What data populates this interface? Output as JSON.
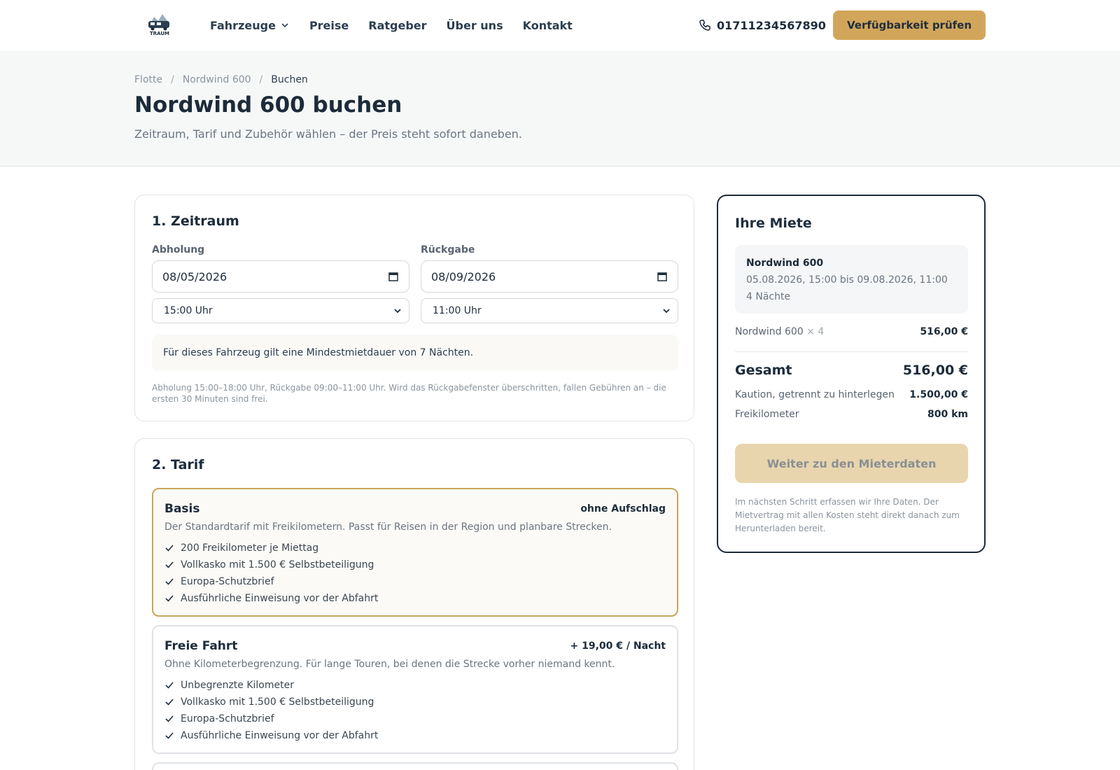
{
  "header": {
    "logo_text": "TRAUM",
    "nav": [
      {
        "label": "Fahrzeuge",
        "has_dropdown": true
      },
      {
        "label": "Preise"
      },
      {
        "label": "Ratgeber"
      },
      {
        "label": "Über uns"
      },
      {
        "label": "Kontakt"
      }
    ],
    "phone": "01711234567890",
    "cta_label": "Verfügbarkeit prüfen"
  },
  "hero": {
    "breadcrumb": [
      "Flotte",
      "Nordwind 600",
      "Buchen"
    ],
    "breadcrumb_sep": "/",
    "title": "Nordwind 600 buchen",
    "subtitle": "Zeitraum, Tarif und Zubehör wählen – der Preis steht sofort daneben."
  },
  "period": {
    "heading": "1. Zeitraum",
    "pickup_label": "Abholung",
    "pickup_date": "08/05/2026",
    "pickup_time": "15:00 Uhr",
    "return_label": "Rückgabe",
    "return_date": "08/09/2026",
    "return_time": "11:00 Uhr",
    "notice": "Für dieses Fahrzeug gilt eine Mindestmietdauer von 7 Nächten.",
    "fine_print": "Abholung 15:00–18:00 Uhr, Rückgabe 09:00–11:00 Uhr. Wird das Rückgabefenster überschritten, fallen Gebühren an – die ersten 30 Minuten sind frei."
  },
  "tariff": {
    "heading": "2. Tarif",
    "options": [
      {
        "name": "Basis",
        "price": "ohne Aufschlag",
        "description": "Der Standardtarif mit Freikilometern. Passt für Reisen in der Region und planbare Strecken.",
        "features": [
          "200 Freikilometer je Miettag",
          "Vollkasko mit 1.500 € Selbstbeteiligung",
          "Europa-Schutzbrief",
          "Ausführliche Einweisung vor der Abfahrt"
        ],
        "selected": true
      },
      {
        "name": "Freie Fahrt",
        "price": "+ 19,00 € / Nacht",
        "description": "Ohne Kilometerbegrenzung. Für lange Touren, bei denen die Strecke vorher niemand kennt.",
        "features": [
          "Unbegrenzte Kilometer",
          "Vollkasko mit 1.500 € Selbstbeteiligung",
          "Europa-Schutzbrief",
          "Ausführliche Einweisung vor der Abfahrt"
        ],
        "selected": false
      }
    ]
  },
  "summary": {
    "heading": "Ihre Miete",
    "vehicle": "Nordwind 600",
    "dates": "05.08.2026, 15:00 bis 09.08.2026, 11:00",
    "nights": "4 Nächte",
    "line_label": "Nordwind 600",
    "line_mult": "× 4",
    "line_value": "516,00 €",
    "total_label": "Gesamt",
    "total_value": "516,00 €",
    "deposit_label": "Kaution, getrennt zu hinterlegen",
    "deposit_value": "1.500,00 €",
    "km_label": "Freikilometer",
    "km_value": "800 km",
    "cta_label": "Weiter zu den Mieterdaten",
    "note": "Im nächsten Schritt erfassen wir Ihre Daten. Der Mietvertrag mit allen Kosten steht direkt danach zum Herunterladen bereit."
  },
  "colors": {
    "accent": "#d2a65a",
    "accent_disabled": "#e8d5ae",
    "text_dark": "#1c2b3a",
    "selected_border": "#c9a55a"
  }
}
